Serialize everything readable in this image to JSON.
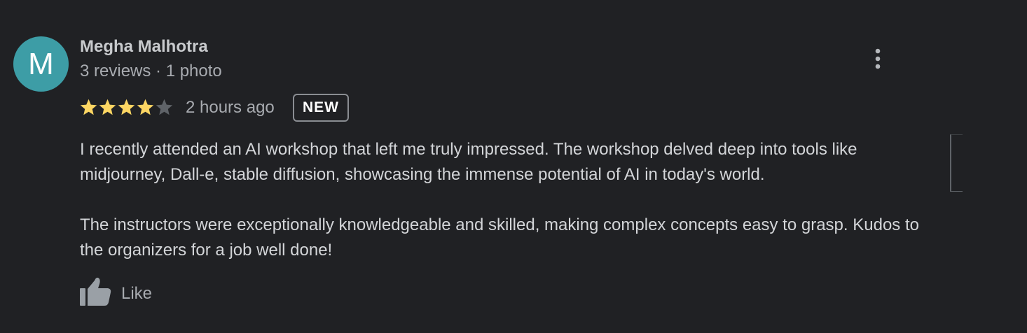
{
  "review": {
    "avatar_letter": "M",
    "avatar_color": "#3d9da6",
    "reviewer_name": "Megha Malhotra",
    "reviewer_meta": "3 reviews · 1 photo",
    "rating": 4,
    "rating_max": 5,
    "star_filled_color": "#fdd663",
    "star_empty_color": "#5f6368",
    "time_ago": "2 hours ago",
    "badge": "NEW",
    "paragraphs": [
      "I recently attended an AI workshop that left me truly impressed. The workshop delved deep into tools like midjourney, Dall-e, stable diffusion, showcasing the immense potential of AI in today's world.",
      "The instructors were exceptionally knowledgeable and skilled, making complex concepts easy to grasp. Kudos to the organizers for a job well done!"
    ],
    "like_label": "Like",
    "more_icon": "more-vertical-icon",
    "like_icon": "thumbs-up-icon"
  }
}
